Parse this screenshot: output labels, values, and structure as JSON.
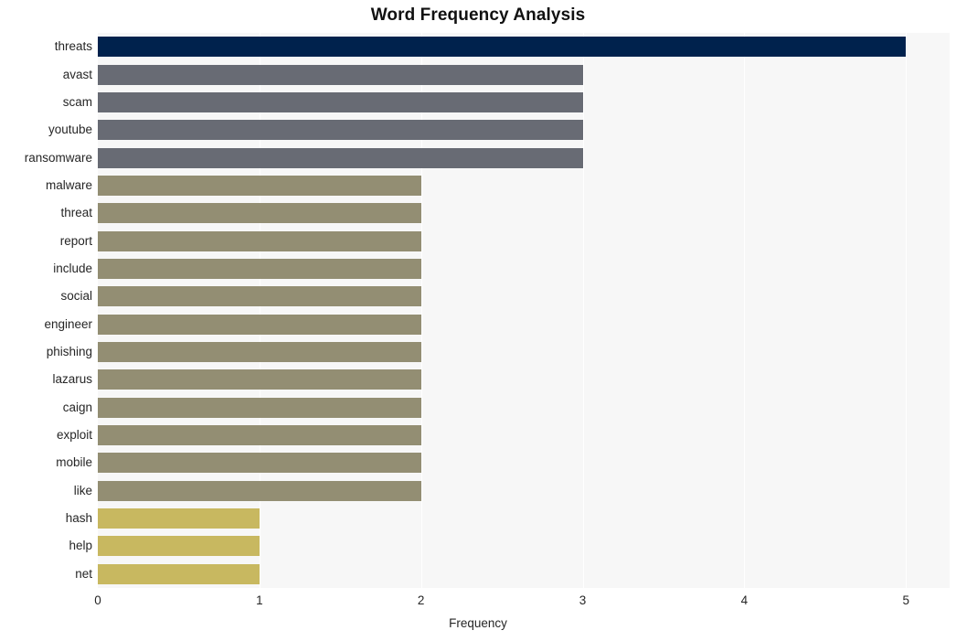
{
  "chart_data": {
    "type": "bar",
    "orientation": "horizontal",
    "title": "Word Frequency Analysis",
    "xlabel": "Frequency",
    "ylabel": "",
    "xlim": [
      0,
      5.27
    ],
    "xticks": [
      0,
      1,
      2,
      3,
      4,
      5
    ],
    "xtick_labels": [
      "0",
      "1",
      "2",
      "3",
      "4",
      "5"
    ],
    "grid": true,
    "grid_axis": "x",
    "legend": null,
    "categories": [
      "threats",
      "avast",
      "scam",
      "youtube",
      "ransomware",
      "malware",
      "threat",
      "report",
      "include",
      "social",
      "engineer",
      "phishing",
      "lazarus",
      "caign",
      "exploit",
      "mobile",
      "like",
      "hash",
      "help",
      "net"
    ],
    "values": [
      5,
      3,
      3,
      3,
      3,
      2,
      2,
      2,
      2,
      2,
      2,
      2,
      2,
      2,
      2,
      2,
      2,
      1,
      1,
      1
    ],
    "bar_colors": [
      "#00224d",
      "#686b74",
      "#686b74",
      "#686b74",
      "#686b74",
      "#938e73",
      "#938e73",
      "#938e73",
      "#938e73",
      "#938e73",
      "#938e73",
      "#938e73",
      "#938e73",
      "#938e73",
      "#938e73",
      "#938e73",
      "#938e73",
      "#c8b860",
      "#c8b860",
      "#c8b860"
    ]
  },
  "style": {
    "plot_background": "#f7f7f7",
    "figure_background": "#ffffff",
    "gridline_color": "#ffffff",
    "text_color": "#262626",
    "title_color": "#111111"
  }
}
